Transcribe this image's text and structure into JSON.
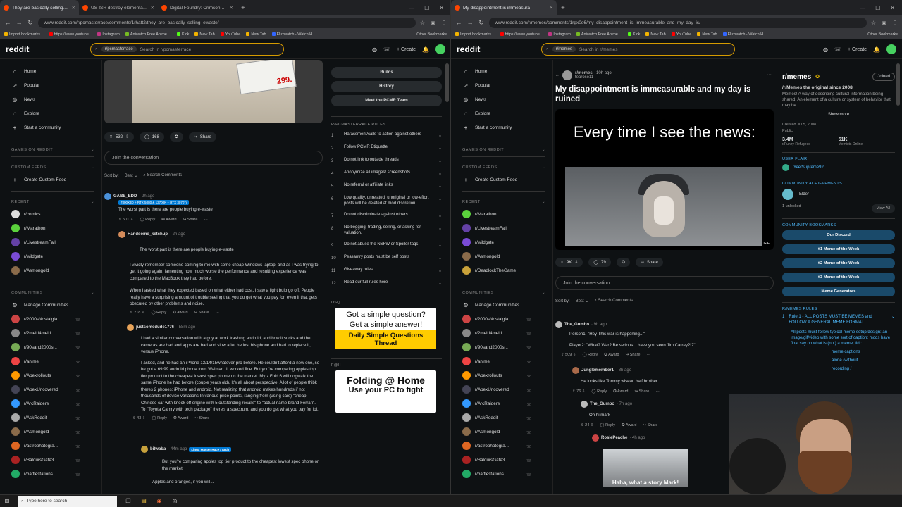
{
  "left": {
    "tabs": [
      {
        "title": "They are basically selling e-Wast",
        "active": true
      },
      {
        "title": "US-ISR destroy elementary scho",
        "active": false
      },
      {
        "title": "Digital Foundry: Crimson Desert",
        "active": false
      }
    ],
    "url": "www.reddit.com/r/pcmasterrace/comments/1rhatt2/they_are_basically_selling_ewaste/",
    "search_chip": "r/pcmasterrace",
    "search_placeholder": "Search in r/pcmasterrace",
    "price": "299.",
    "post_actions": {
      "votes": "532",
      "comments": "168",
      "share": "Share"
    },
    "join_placeholder": "Join the conversation",
    "sort_label": "Sort by:",
    "sort_value": "Best",
    "search_comments": "Search Comments",
    "comments": [
      {
        "user": "GABE_EDD",
        "ago": "· 2h ago",
        "flair": "7800X3D + RTX 5080 & 13700K + RTX 3070Ti",
        "text": "The worst part is there are people buying e-waste",
        "votes": "501",
        "reply": "Reply",
        "award": "Award",
        "share": "Share"
      },
      {
        "user": "Handsome_ketchup",
        "ago": "· 2h ago",
        "quote": "The worst part is there are people buying e-waste",
        "p1": "I vividly remember someone coming to me with some cheap Windows laptop, and as I was trying to get it going again, lamenting how much worse the performance and resulting experience was compared to the MacBook they had before.",
        "p2": "When I asked what they expected based on what either had cost, I saw a light bulb go off. People really have a surprising amount of trouble seeing that you do get what you pay for, even if that gets obscured by other problems and noise.",
        "votes": "218"
      },
      {
        "user": "justsomedude1776",
        "ago": "· 58m ago",
        "p1": "I had a similar conversation with a guy at work trashing android, and how it sucks and the cameras are bad and apps are bad and slow after he lost his phone and had to replace it, versus iPhone.",
        "p2": "I asked, and he had an iPhone 13/14/15whatever-pro before. He couldn't afford a new one, so he got a 69.99 android phone from Walmart. It worked fine. But you're comparing apples top tier product to the cheapest lowest spec phone on the market. My z Fold 6 will dogwalk the same iPhone he had before (couple years old). It's all about perspective. A lot of people thibk theres 2 phones: iPhone and android. Not realizing that android makes hundreds if not thousands of device variations In various price points, ranging from (using cars) \"cheap Chinese car with knock off engine with 5 outstanding recalls\" to \"actual name brand Ferrari\". To \"Toyota Camry with tech package\" there's a spectrum, and you do get what you pay for lol.",
        "votes": "43"
      },
      {
        "user": "bitwaba",
        "ago": "· 44m ago",
        "flair": "Linux Master Race / Arch",
        "text": "But you're comparing apples top tier product to the cheapest lowest spec phone on the market",
        "text2": "Apples and oranges, if you will..."
      }
    ],
    "right_buttons": [
      "Builds",
      "History",
      "Meet the PCMR Team"
    ],
    "rules_heading": "R/PCMASTERRACE RULES",
    "rules": [
      "Harassment/calls to action against others",
      "Follow PCMR Etiquette",
      "Do not link to outside threads",
      "Anonymize all images/ screenshots",
      "No referral or affiliate links",
      "Low quality, unrelated, unoriginal or low-effort posts will be deleted at mod discretion.",
      "Do not discriminate against others",
      "No begging, trading, selling, or asking for valuation.",
      "Do not abuse the NSFW or Spoiler tags",
      "Peasantry posts must be self posts",
      "Giveaway rules",
      "Read our full rules here"
    ],
    "dsq": "DSQ",
    "ad1": {
      "l1": "Got a simple question?",
      "l2": "Get a simple answer!",
      "l3": "Daily Simple Questions Thread"
    },
    "fah": "F@H",
    "ad2": {
      "l1": "Folding @ Home",
      "l2": "Use your PC to fight"
    }
  },
  "right": {
    "tabs": [
      {
        "title": "My disappointment is immeasura",
        "active": true
      }
    ],
    "url": "www.reddit.com/r/memes/comments/1rgx0e6/my_disappointment_is_immeasurable_and_my_day_is/",
    "search_chip": "r/memes",
    "search_placeholder": "Search in r/memes",
    "post": {
      "sub": "r/memes",
      "ago": "· 10h ago",
      "author": "tearose11",
      "title": "My disappointment is immeasurable and my day is ruined",
      "meme_text": "Every time I see the news:",
      "gif": "GIF",
      "votes": "9K",
      "comments": "79",
      "share": "Share"
    },
    "join_placeholder": "Join the conversation",
    "sort_label": "Sort by:",
    "sort_value": "Best",
    "search_comments": "Search Comments",
    "comments": [
      {
        "user": "The_Gumbo",
        "ago": "· 9h ago",
        "l1": "Person1: \"Hey This war is happening...\"",
        "l2": "Player2: \"What? War? Be serious... have you seen Jim Carrey?!?\"",
        "votes": "509"
      },
      {
        "user": "Junglemember1",
        "ago": "· 8h ago",
        "text": "He looks like Tommy wiseau half brother",
        "votes": "76"
      },
      {
        "user": "The_Gumbo",
        "ago": "· 7h ago",
        "text": "Oh hi mark",
        "votes": "24"
      },
      {
        "user": "RosiePeache",
        "ago": "· 4h ago",
        "caption": "Haha, what a story Mark!"
      }
    ],
    "actions": {
      "reply": "Reply",
      "award": "Award",
      "share": "Share"
    },
    "side": {
      "name": "r/memes",
      "joined": "Joined",
      "tagline": "/r/Memes the original since 2008",
      "desc": "Memes! A way of describing cultural information being shared. An element of a culture or system of behavior that may be...",
      "show_more": "Show more",
      "created": "Created Jul 5, 2008",
      "public": "Public",
      "members": "3.4M",
      "members_label": "r/Funny Refugees",
      "online": "51K",
      "online_label": "Memists Online",
      "user_flair_hd": "USER FLAIR",
      "user_flair": "YeetSupreme92",
      "ach_hd": "COMMUNITY ACHIEVEMENTS",
      "ach": "Elder",
      "unlocked": "1 unlocked",
      "view_all": "View All",
      "bm_hd": "COMMUNITY BOOKMARKS",
      "bookmarks": [
        "Our Discord",
        "#1 Meme of the Week",
        "#2 Meme of the Week",
        "#3 Meme of the Week",
        "Meme Generators"
      ],
      "rules_hd": "R/MEMES RULES",
      "rule1": "Rule 1 - ALL POSTS MUST BE MEMES and FOLLOW A GENERAL MEME FORMAT",
      "rule_text": "All posts must follow typical meme setup/design: an image/gif/video with some sort of caption; mods have final say on what is (not) a meme; tldr:",
      "extra": [
        "meme captions",
        "alone (without",
        "recording /"
      ]
    }
  },
  "sidebar": {
    "nav": [
      "Home",
      "Popular",
      "News",
      "Explore",
      "Start a community"
    ],
    "games": "GAMES ON REDDIT",
    "custom": "CUSTOM FEEDS",
    "create_feed": "Create Custom Feed",
    "recent": "RECENT",
    "communities": "COMMUNITIES",
    "manage": "Manage Communities",
    "recent_left": [
      "r/comics",
      "r/Marathon",
      "r/LivestreamFail",
      "r/wildgate",
      "r/Asmongold"
    ],
    "recent_right": [
      "r/Marathon",
      "r/LivestreamFail",
      "r/wildgate",
      "r/Asmongold",
      "r/DeadlockTheGame"
    ],
    "comm_left": [
      "r/2000sNostalgia",
      "r/2meirl4meirl",
      "r/90sand2000s...",
      "r/anime",
      "r/Apexrollouts",
      "r/ApexUncovered",
      "r/ArcRaiders",
      "r/AskReddit",
      "r/Asmongold",
      "r/astrophotogra...",
      "r/BaldursGate3",
      "r/battlestations"
    ],
    "comm_right": [
      "r/2000sNostalgia",
      "r/2meirl4meirl",
      "r/90sand2000s...",
      "r/anime",
      "r/Apexrollouts",
      "r/ApexUncovered",
      "r/ArcRaiders",
      "r/AskReddit",
      "r/Asmongold",
      "r/astrophotogra...",
      "r/BaldursGate3",
      "r/battlestations"
    ]
  },
  "header": {
    "logo": "reddit",
    "create": "Create"
  },
  "bookmarks": [
    "Import bookmarks...",
    "https://www.youtube...",
    "Instagram",
    "Aniwatch Free Anime ...",
    "Kick",
    "New Tab",
    "YouTube",
    "New Tab",
    "Fluxwatch - Watch H..."
  ],
  "other_bookmarks": "Other Bookmarks",
  "taskbar": {
    "search": "Type here to search"
  },
  "colors": {
    "accent": "#ff4500",
    "bg": "#0e1113",
    "flair": "#0079d3",
    "ad_yellow": "#ffcc00"
  }
}
